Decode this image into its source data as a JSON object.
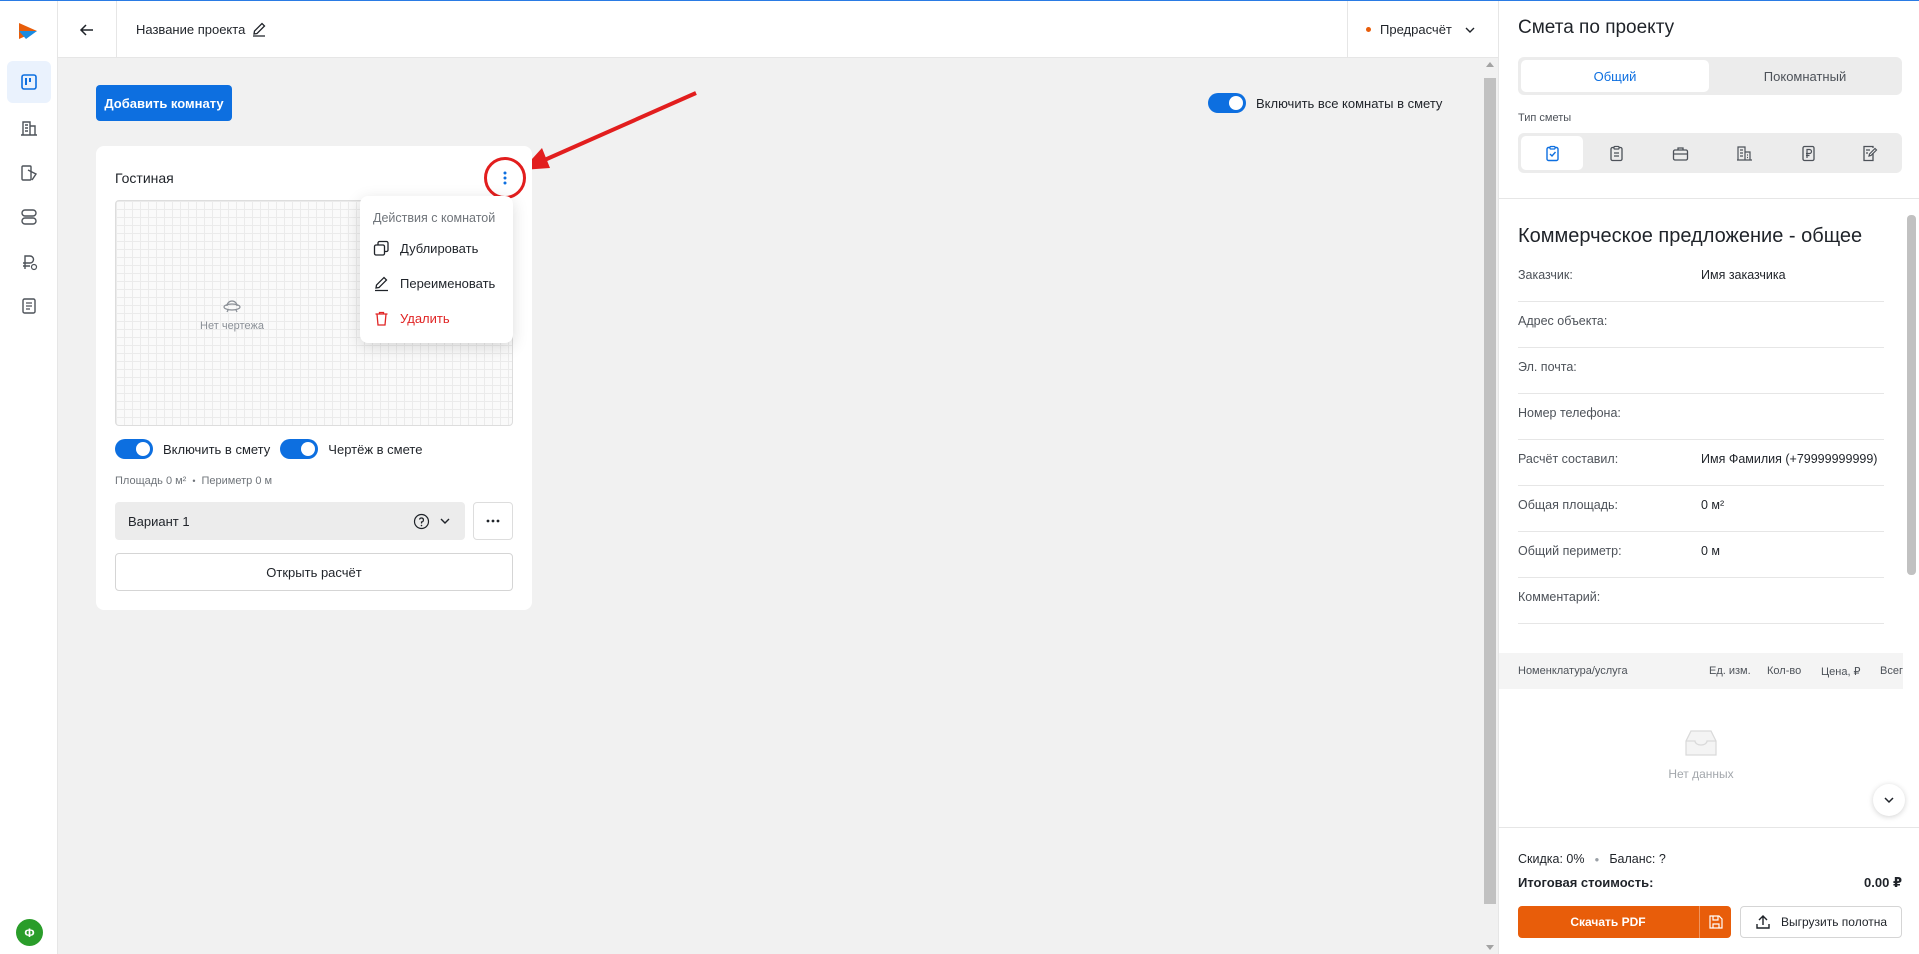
{
  "header": {
    "project_name": "Название проекта",
    "status": "Предрасчёт"
  },
  "toolbar": {
    "add_room_label": "Добавить комнату",
    "include_all_label": "Включить все комнаты в смету"
  },
  "room": {
    "title": "Гостиная",
    "no_drawing": "Нет чертежа",
    "include_label": "Включить в смету",
    "drawing_label": "Чертёж в смете",
    "area": "Площадь 0 м²",
    "perimeter": "Периметр 0 м",
    "variant": "Вариант 1",
    "open_calc": "Открыть расчёт"
  },
  "context_menu": {
    "header": "Действия с комнатой",
    "items": [
      "Дублировать",
      "Переименовать",
      "Удалить"
    ]
  },
  "estimate": {
    "title": "Смета по проекту",
    "tabs": [
      "Общий",
      "Покомнатный"
    ],
    "type_label": "Тип сметы",
    "offer_title": "Коммерческое предложение - общее",
    "fields": [
      {
        "label": "Заказчик:",
        "value": "Имя заказчика"
      },
      {
        "label": "Адрес объекта:",
        "value": ""
      },
      {
        "label": "Эл. почта:",
        "value": ""
      },
      {
        "label": "Номер телефона:",
        "value": ""
      },
      {
        "label": "Расчёт составил:",
        "value": "Имя Фамилия (+79999999999)"
      },
      {
        "label": "Общая площадь:",
        "value": "0 м²"
      },
      {
        "label": "Общий периметр:",
        "value": "0 м"
      },
      {
        "label": "Комментарий:",
        "value": ""
      }
    ],
    "table_headers": [
      "Номенклатура/услуга",
      "Ед. изм.",
      "Кол-во",
      "Цена, ₽",
      "Всего"
    ],
    "empty": "Нет данных",
    "discount": "Скидка: 0%",
    "balance": "Баланс: ?",
    "total_label": "Итоговая стоимость:",
    "total_value": "0.00 ₽",
    "pdf_label": "Скачать PDF",
    "export_label": "Выгрузить полотна"
  },
  "user": {
    "initial": "Ф"
  },
  "colors": {
    "primary": "#0d6fe0",
    "accent": "#e85d0a",
    "danger": "#e02424",
    "annotation": "#e21e1e"
  }
}
